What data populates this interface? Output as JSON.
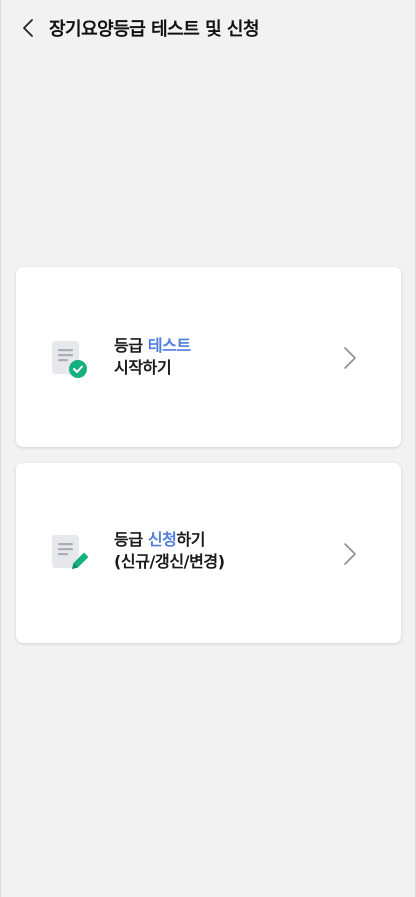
{
  "header": {
    "back_icon": "chevron-left-icon",
    "title": "장기요양등급 테스트 및 신청"
  },
  "cards": [
    {
      "icon": "document-check-icon",
      "line1_prefix": "등급 ",
      "line1_accent": "테스트",
      "line1_suffix": "",
      "line2": "시작하기",
      "chevron_icon": "chevron-right-icon"
    },
    {
      "icon": "document-edit-icon",
      "line1_prefix": "등급 ",
      "line1_accent": "신청",
      "line1_suffix": "하기",
      "line2": "(신규/갱신/변경)",
      "chevron_icon": "chevron-right-icon"
    }
  ],
  "colors": {
    "accent": "#4f7de0",
    "icon_green": "#16b07f",
    "background": "#f2f2f2"
  }
}
